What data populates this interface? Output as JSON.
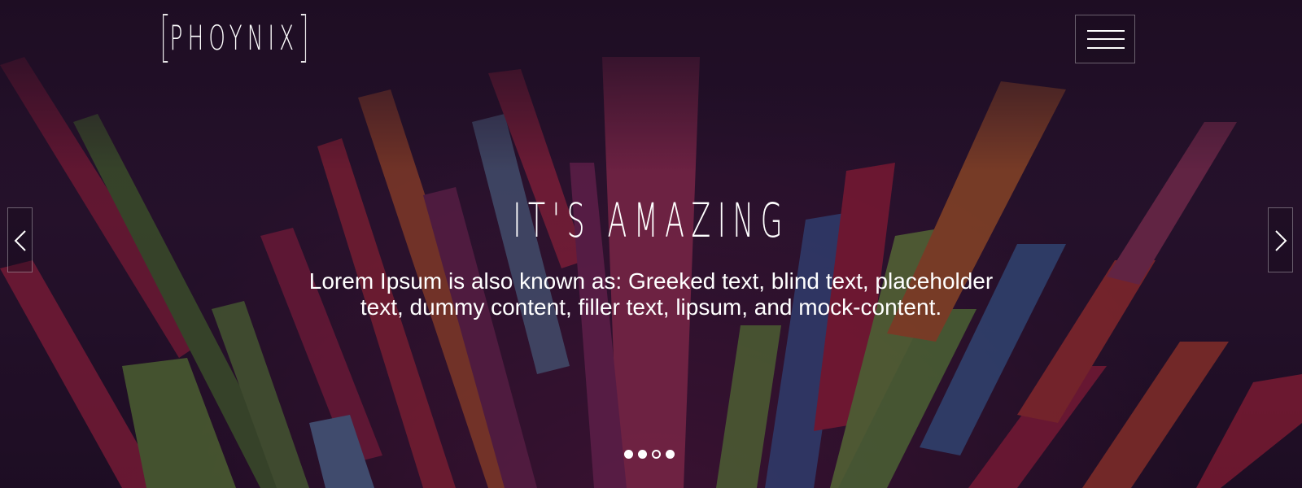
{
  "header": {
    "logo_text": "PHOYNIX",
    "menu_icon": "hamburger-menu-icon"
  },
  "slider": {
    "title": "IT'S AMAZING",
    "subtitle": "Lorem Ipsum is also known as: Greeked text, blind text, placeholder text, dummy content, filler text, lipsum, and mock-content.",
    "prev_icon": "chevron-left-icon",
    "next_icon": "chevron-right-icon",
    "slide_count": 4,
    "active_slide": 3
  },
  "colors": {
    "text": "#ffffff",
    "background": "#25132c"
  }
}
